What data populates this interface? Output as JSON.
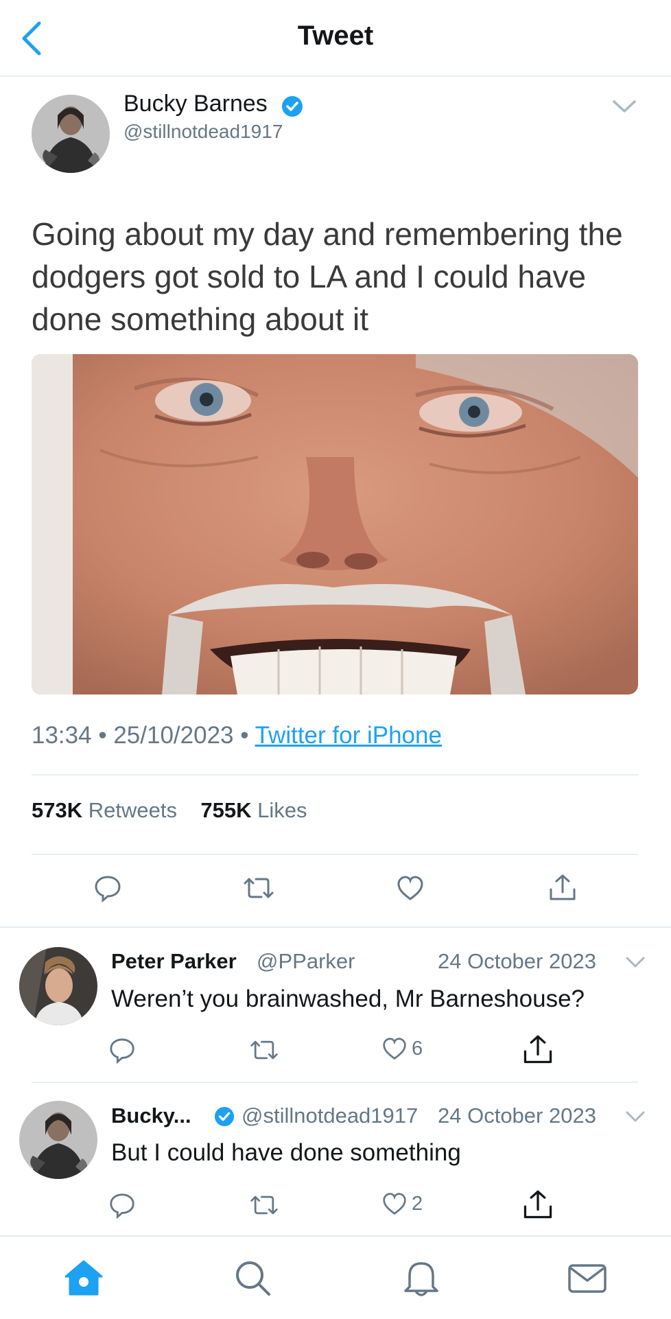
{
  "header": {
    "title": "Tweet",
    "back_icon": "chevron-left-icon",
    "accent": "#1da1f2"
  },
  "tweet": {
    "author_name": "Bucky Barnes",
    "author_handle": "@stillnotdead1917",
    "verified": true,
    "text": "Going about my day and remembering the dodgers got sold to LA and I could have done something about it",
    "time": "13:34",
    "date": "25/10/2023",
    "separator": "•",
    "source": "Twitter for iPhone",
    "retweets_count": "573K",
    "retweets_label": "Retweets",
    "likes_count": "755K",
    "likes_label": "Likes"
  },
  "replies": [
    {
      "name": "Peter Parker",
      "handle": "@PParker",
      "date": "24 October 2023",
      "text": "Weren’t you brainwashed, Mr Barneshouse?",
      "likes": "6"
    },
    {
      "name": "Bucky...",
      "handle": "@stillnotdead1917",
      "verified": true,
      "date": "24 October 2023",
      "text": "But I could have done something",
      "likes": "2"
    }
  ],
  "tabs": [
    "home-icon",
    "search-icon",
    "bell-icon",
    "mail-icon"
  ],
  "colors": {
    "blue": "#1da1f2",
    "grey": "#657786",
    "divider": "#e6ecf0"
  }
}
